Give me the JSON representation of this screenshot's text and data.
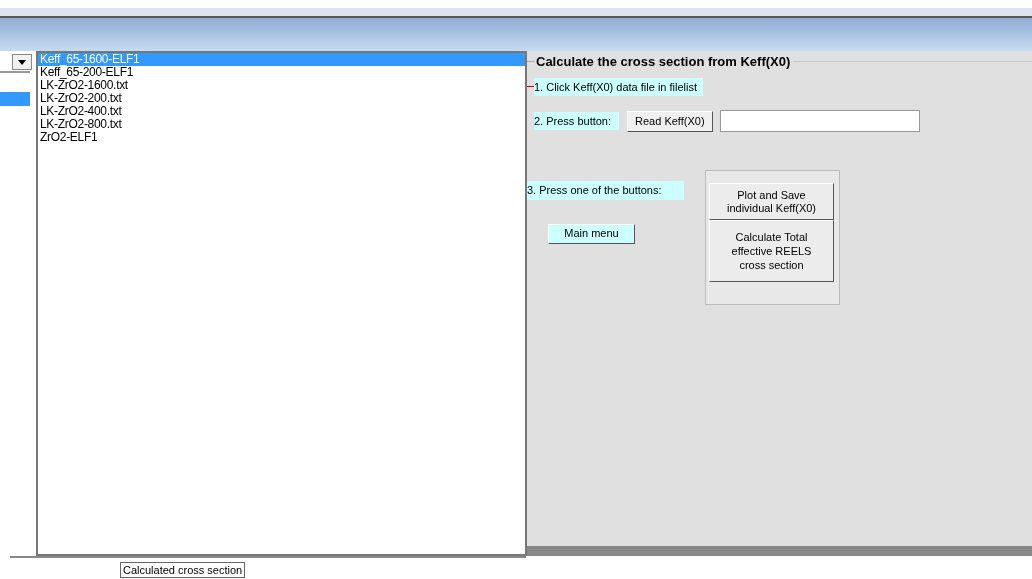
{
  "file_list": {
    "items": [
      {
        "label": "Keff_65-1600-ELF1",
        "selected": true
      },
      {
        "label": "Keff_65-200-ELF1",
        "selected": false
      },
      {
        "label": "LK-ZrO2-1600.txt",
        "selected": false
      },
      {
        "label": "LK-ZrO2-200.txt",
        "selected": false
      },
      {
        "label": "LK-ZrO2-400.txt",
        "selected": false
      },
      {
        "label": "LK-ZrO2-800.txt",
        "selected": false
      },
      {
        "label": "ZrO2-ELF1",
        "selected": false
      }
    ]
  },
  "group": {
    "title": "Calculate the cross section from Keff(X0)",
    "step_1": "1. Click Keff(X0) data file in filelist",
    "step_2": "2. Press button:",
    "read_button": "Read Keff(X0)",
    "step_3": "3. Press one of the buttons:",
    "main_menu_button": "Main menu",
    "plot_button": "Plot and Save individual Keff(X0)",
    "calculate_button": "Calculate Total effective REELS cross section"
  },
  "status_tooltip": "Calculated cross section"
}
